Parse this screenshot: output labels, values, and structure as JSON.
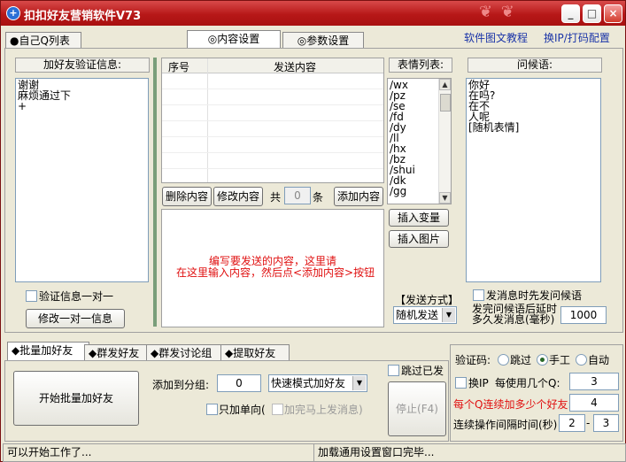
{
  "title": "扣扣好友营销软件V73",
  "tabs": [
    "●自己Q列表",
    "◎内容设置",
    "◎参数设置"
  ],
  "links": {
    "tutorial": "软件图文教程",
    "switch_ip": "换IP/打码配置"
  },
  "verify": {
    "header": "加好友验证信息:",
    "text": "谢谢\n麻烦通过下\n+",
    "one_to_one_label": "验证信息一对一",
    "edit_one_to_one_button": "修改一对一信息"
  },
  "content_table": {
    "col_no": "序号",
    "col_content": "发送内容",
    "delete_button": "删除内容",
    "modify_button": "修改内容",
    "total_prefix": "共",
    "count": "0",
    "total_suffix": "条",
    "add_button": "添加内容",
    "hint_line1": "编写要发送的内容，这里请",
    "hint_line2": "在这里输入内容，然后点<添加内容>按钮"
  },
  "emoji": {
    "header": "表情列表:",
    "items": [
      "/wx",
      "/pz",
      "/se",
      "/fd",
      "/dy",
      "/ll",
      "/hx",
      "/bz",
      "/shui",
      "/dk",
      "/gg"
    ],
    "insert_var_button": "插入变量",
    "insert_img_button": "插入图片"
  },
  "send_mode": {
    "label": "【发送方式】",
    "value": "随机发送"
  },
  "greeting": {
    "header": "问候语:",
    "text": "你好\n在吗?\n在不\n人呢\n[随机表情]",
    "greet_first_label": "发消息时先发问候语",
    "delay_label_line1": "发完问候语后延时",
    "delay_label_line2": "多久发消息(毫秒)",
    "delay_value": "1000"
  },
  "bottom_tabs": [
    "◆批量加好友",
    "◆群发好友",
    "◆群发讨论组",
    "◆提取好友"
  ],
  "batch": {
    "start_button": "开始批量加好友",
    "group_label": "添加到分组:",
    "group_value": "0",
    "mode_value": "快速模式加好友",
    "single_dir_label": "只加单向(",
    "send_after_label": "加完马上发消息)",
    "skip_sent_label": "跳过已发",
    "stop_button": "停止(F4)"
  },
  "captcha": {
    "label": "验证码:",
    "options": [
      "跳过",
      "手工",
      "自动"
    ],
    "selected": "手工"
  },
  "change_ip": {
    "label": "换IP",
    "per_q_label": "每使用几个Q:",
    "per_q_value": "3"
  },
  "per_q_friends": {
    "label": "每个Q连续加多少个好友:",
    "value": "4"
  },
  "interval": {
    "label": "连续操作间隔时间(秒)",
    "from": "2",
    "dash": "-",
    "to": "3"
  },
  "status": {
    "left": "可以开始工作了...",
    "right": "加载通用设置窗口完毕..."
  },
  "colors": {
    "title_bar": "#b71818",
    "link": "#1a34a8",
    "hint": "#e01010",
    "splitter": "#7a9e7a"
  }
}
